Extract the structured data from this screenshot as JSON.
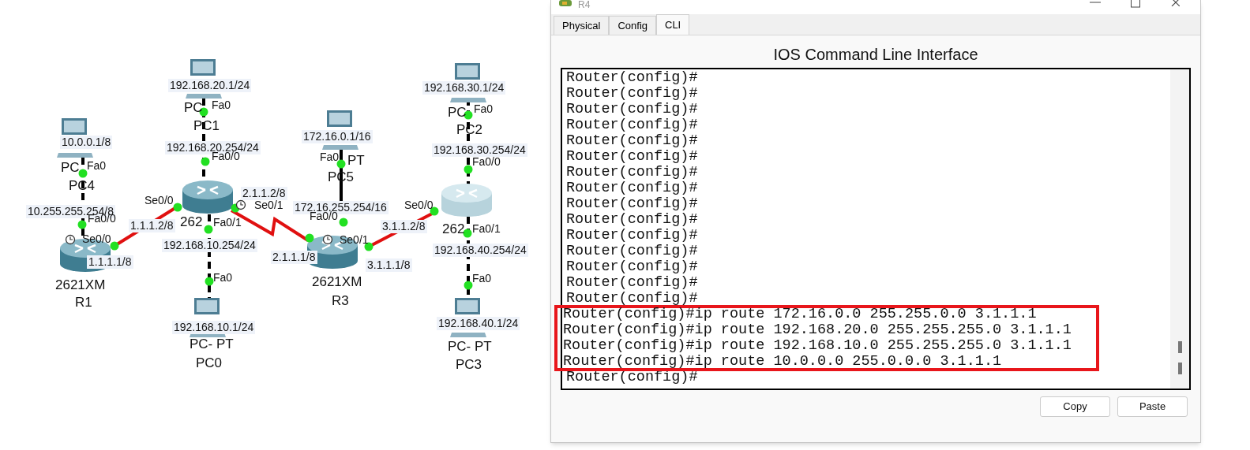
{
  "topology": {
    "links": [
      {
        "kind": "crossover"
      },
      {
        "kind": "crossover"
      },
      {
        "kind": "crossover"
      },
      {
        "kind": "serial"
      },
      {
        "kind": "serial-dce"
      },
      {
        "kind": "straight"
      },
      {
        "kind": "serial"
      },
      {
        "kind": "crossover"
      },
      {
        "kind": "crossover"
      }
    ],
    "devices": [
      {
        "kind": "pc",
        "selected": false
      },
      {
        "kind": "pc",
        "selected": false
      },
      {
        "kind": "pc",
        "selected": false
      },
      {
        "kind": "pc",
        "selected": false
      },
      {
        "kind": "pc",
        "selected": false
      },
      {
        "kind": "pc",
        "selected": false
      },
      {
        "kind": "router",
        "selected": false
      },
      {
        "kind": "router",
        "selected": false
      },
      {
        "kind": "router",
        "selected": false
      },
      {
        "kind": "router",
        "selected": true
      }
    ],
    "labels": [
      {
        "kind": "address",
        "text": "192.168.20.1/24"
      },
      {
        "kind": "model",
        "text": "PC"
      },
      {
        "kind": "interface",
        "text": "Fa0"
      },
      {
        "kind": "name",
        "text": "PC1"
      },
      {
        "kind": "address",
        "text": "192.168.20.254/24"
      },
      {
        "kind": "interface",
        "text": "Fa0/0"
      },
      {
        "kind": "model",
        "text": "262"
      },
      {
        "kind": "interface",
        "text": "Se0/0"
      },
      {
        "kind": "address",
        "text": "1.1.1.2/8"
      },
      {
        "kind": "interface",
        "text": "Fa0/1"
      },
      {
        "kind": "address",
        "text": "2.1.1.2/8"
      },
      {
        "kind": "interface",
        "text": "Se0/1"
      },
      {
        "kind": "address",
        "text": "192.168.10.254/24"
      },
      {
        "kind": "interface",
        "text": "Fa0"
      },
      {
        "kind": "address",
        "text": "192.168.10.1/24"
      },
      {
        "kind": "model",
        "text": "PC- PT"
      },
      {
        "kind": "name",
        "text": "PC0"
      },
      {
        "kind": "address",
        "text": "10.0.0.1/8"
      },
      {
        "kind": "model",
        "text": "PC"
      },
      {
        "kind": "interface",
        "text": "Fa0"
      },
      {
        "kind": "name",
        "text": "PC4"
      },
      {
        "kind": "address",
        "text": "10.255.255.254/8"
      },
      {
        "kind": "interface",
        "text": "Fa0/0"
      },
      {
        "kind": "interface",
        "text": "Se0/0"
      },
      {
        "kind": "address",
        "text": "1.1.1.1/8"
      },
      {
        "kind": "model",
        "text": "2621XM"
      },
      {
        "kind": "name",
        "text": "R1"
      },
      {
        "kind": "address",
        "text": "172.16.0.1/16"
      },
      {
        "kind": "interface",
        "text": "Fa0"
      },
      {
        "kind": "model",
        "text": "PT"
      },
      {
        "kind": "name",
        "text": "PC5"
      },
      {
        "kind": "address",
        "text": "172.16.255.254/16"
      },
      {
        "kind": "interface",
        "text": "Fa0/0"
      },
      {
        "kind": "interface",
        "text": "Se0/1"
      },
      {
        "kind": "address",
        "text": "2.1.1.1/8"
      },
      {
        "kind": "address",
        "text": "3.1.1.1/8"
      },
      {
        "kind": "model",
        "text": "2621XM"
      },
      {
        "kind": "name",
        "text": "R3"
      },
      {
        "kind": "address",
        "text": "192.168.30.1/24"
      },
      {
        "kind": "model",
        "text": "PC"
      },
      {
        "kind": "interface",
        "text": "Fa0"
      },
      {
        "kind": "name",
        "text": "PC2"
      },
      {
        "kind": "address",
        "text": "192.168.30.254/24"
      },
      {
        "kind": "interface",
        "text": "Fa0/0"
      },
      {
        "kind": "interface",
        "text": "Se0/0"
      },
      {
        "kind": "address",
        "text": "3.1.1.2/8"
      },
      {
        "kind": "model",
        "text": "262"
      },
      {
        "kind": "interface",
        "text": "Fa0/1"
      },
      {
        "kind": "address",
        "text": "192.168.40.254/24"
      },
      {
        "kind": "interface",
        "text": "Fa0"
      },
      {
        "kind": "address",
        "text": "192.168.40.1/24"
      },
      {
        "kind": "model",
        "text": "PC- PT"
      },
      {
        "kind": "name",
        "text": "PC3"
      }
    ]
  },
  "window": {
    "title": "R4",
    "tabs": [
      {
        "label": "Physical",
        "selected": false
      },
      {
        "label": "Config",
        "selected": false
      },
      {
        "label": "CLI",
        "selected": true
      }
    ],
    "heading": "IOS Command Line Interface",
    "terminal": [
      {
        "text": "Router(config)#",
        "highlighted": false
      },
      {
        "text": "Router(config)#",
        "highlighted": false
      },
      {
        "text": "Router(config)#",
        "highlighted": false
      },
      {
        "text": "Router(config)#",
        "highlighted": false
      },
      {
        "text": "Router(config)#",
        "highlighted": false
      },
      {
        "text": "Router(config)#",
        "highlighted": false
      },
      {
        "text": "Router(config)#",
        "highlighted": false
      },
      {
        "text": "Router(config)#",
        "highlighted": false
      },
      {
        "text": "Router(config)#",
        "highlighted": false
      },
      {
        "text": "Router(config)#",
        "highlighted": false
      },
      {
        "text": "Router(config)#",
        "highlighted": false
      },
      {
        "text": "Router(config)#",
        "highlighted": false
      },
      {
        "text": "Router(config)#",
        "highlighted": false
      },
      {
        "text": "Router(config)#",
        "highlighted": false
      },
      {
        "text": "Router(config)#",
        "highlighted": false
      },
      {
        "text": "Router(config)#ip route 172.16.0.0 255.255.0.0 3.1.1.1",
        "highlighted": true
      },
      {
        "text": "Router(config)#ip route 192.168.20.0 255.255.255.0 3.1.1.1",
        "highlighted": true
      },
      {
        "text": "Router(config)#ip route 192.168.10.0 255.255.255.0 3.1.1.1",
        "highlighted": true
      },
      {
        "text": "Router(config)#ip route 10.0.0.0 255.0.0.0 3.1.1.1",
        "highlighted": true
      },
      {
        "text": "Router(config)#",
        "highlighted": false
      }
    ],
    "buttons": [
      "Copy",
      "Paste"
    ]
  }
}
